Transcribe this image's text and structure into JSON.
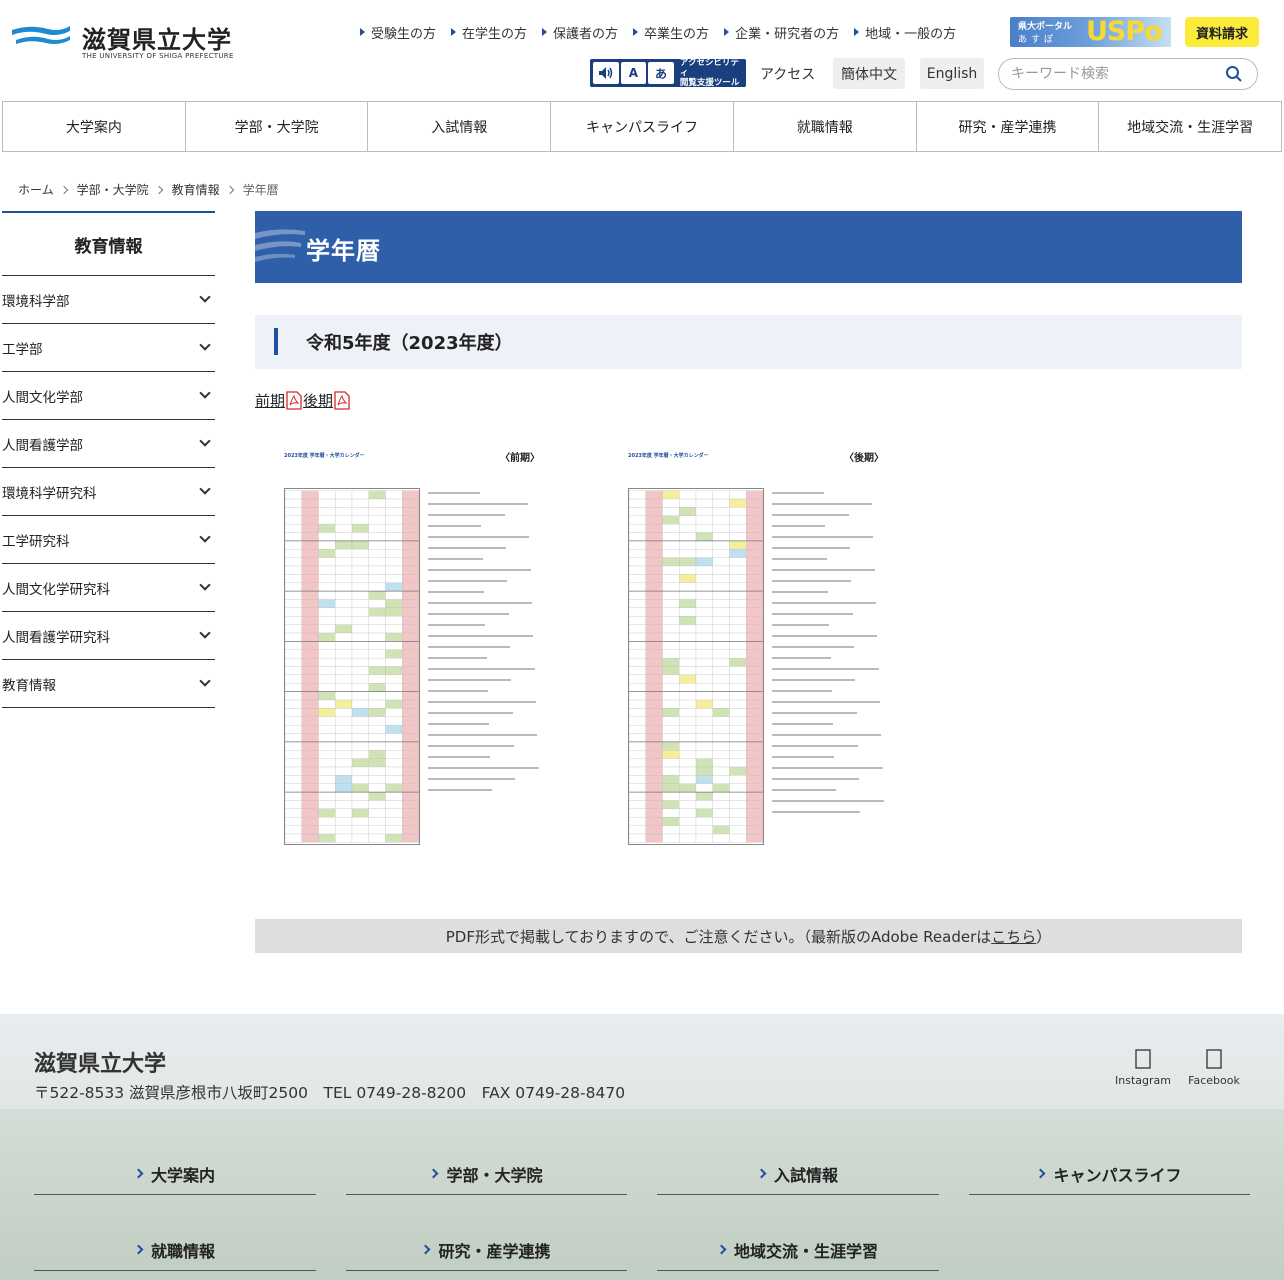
{
  "header": {
    "logo_name": "滋賀県立大学",
    "logo_en": "THE UNIVERSITY OF SHIGA PREFECTURE",
    "audience_links": [
      "受験生の方",
      "在学生の方",
      "保護者の方",
      "卒業生の方",
      "企業・研究者の方",
      "地域・一般の方"
    ],
    "uspo_line1": "県大ポータル",
    "uspo_line2": "あすぽ",
    "uspo_big": "USPo",
    "request_label": "資料請求",
    "a11y_text_1": "アクセシビリティ",
    "a11y_text_2": "閲覧支援ツール",
    "access_label": "アクセス",
    "zh_label": "簡体中文",
    "en_label": "English",
    "search_placeholder": "キーワード検索"
  },
  "global_nav": [
    "大学案内",
    "学部・大学院",
    "入試情報",
    "キャンパスライフ",
    "就職情報",
    "研究・産学連携",
    "地域交流・生涯学習"
  ],
  "breadcrumb": [
    "ホーム",
    "学部・大学院",
    "教育情報",
    "学年暦"
  ],
  "sidebar": {
    "title": "教育情報",
    "items": [
      "環境科学部",
      "工学部",
      "人間文化学部",
      "人間看護学部",
      "環境科学研究科",
      "工学研究科",
      "人間文化学研究科",
      "人間看護学研究科",
      "教育情報"
    ]
  },
  "main": {
    "page_title": "学年暦",
    "section_title": "令和5年度（2023年度）",
    "link_first": "前期",
    "link_second": "後期",
    "cal1_title": "2023年度 学年暦・大学カレンダー",
    "cal1_term": "〈前期〉",
    "cal2_title": "2023年度 学年暦・大学カレンダー",
    "cal2_term": "〈後期〉",
    "notice_text": "PDF形式で掲載しておりますので、ご注意ください。（最新版のAdobe Readerは",
    "notice_link": "こちら",
    "notice_end": "）"
  },
  "footer": {
    "name": "滋賀県立大学",
    "address": "〒522-8533 滋賀県彦根市八坂町2500　TEL 0749-28-8200　FAX 0749-28-8470",
    "instagram": "Instagram",
    "facebook": "Facebook",
    "links": [
      "大学案内",
      "学部・大学院",
      "入試情報",
      "キャンパスライフ",
      "就職情報",
      "研究・産学連携",
      "地域交流・生涯学習"
    ]
  },
  "colors": {
    "brand_blue": "#2f5fa8",
    "accent_yellow": "#fbec3b",
    "pdf_red": "#d9262b"
  }
}
